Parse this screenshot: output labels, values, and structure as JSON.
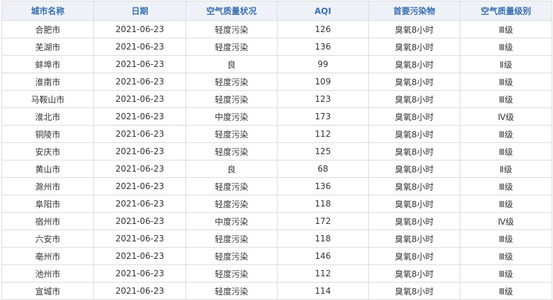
{
  "table": {
    "headers": [
      "城市名称",
      "日期",
      "空气质量状况",
      "AQI",
      "首要污染物",
      "空气质量级别"
    ],
    "rows": [
      [
        "合肥市",
        "2021-06-23",
        "轻度污染",
        "126",
        "臭氧8小时",
        "Ⅲ级"
      ],
      [
        "芜湖市",
        "2021-06-23",
        "轻度污染",
        "136",
        "臭氧8小时",
        "Ⅲ级"
      ],
      [
        "蚌埠市",
        "2021-06-23",
        "良",
        "99",
        "臭氧8小时",
        "Ⅱ级"
      ],
      [
        "淮南市",
        "2021-06-23",
        "轻度污染",
        "109",
        "臭氧8小时",
        "Ⅲ级"
      ],
      [
        "马鞍山市",
        "2021-06-23",
        "轻度污染",
        "123",
        "臭氧8小时",
        "Ⅲ级"
      ],
      [
        "淮北市",
        "2021-06-23",
        "中度污染",
        "173",
        "臭氧8小时",
        "Ⅳ级"
      ],
      [
        "铜陵市",
        "2021-06-23",
        "轻度污染",
        "112",
        "臭氧8小时",
        "Ⅲ级"
      ],
      [
        "安庆市",
        "2021-06-23",
        "轻度污染",
        "125",
        "臭氧8小时",
        "Ⅲ级"
      ],
      [
        "黄山市",
        "2021-06-23",
        "良",
        "68",
        "臭氧8小时",
        "Ⅱ级"
      ],
      [
        "滁州市",
        "2021-06-23",
        "轻度污染",
        "136",
        "臭氧8小时",
        "Ⅲ级"
      ],
      [
        "阜阳市",
        "2021-06-23",
        "轻度污染",
        "118",
        "臭氧8小时",
        "Ⅲ级"
      ],
      [
        "宿州市",
        "2021-06-23",
        "中度污染",
        "172",
        "臭氧8小时",
        "Ⅳ级"
      ],
      [
        "六安市",
        "2021-06-23",
        "轻度污染",
        "118",
        "臭氧8小时",
        "Ⅲ级"
      ],
      [
        "亳州市",
        "2021-06-23",
        "轻度污染",
        "146",
        "臭氧8小时",
        "Ⅲ级"
      ],
      [
        "池州市",
        "2021-06-23",
        "轻度污染",
        "112",
        "臭氧8小时",
        "Ⅲ级"
      ],
      [
        "宣城市",
        "2021-06-23",
        "轻度污染",
        "114",
        "臭氧8小时",
        "Ⅲ级"
      ]
    ]
  },
  "colors": {
    "header_text": "#3a6fb2",
    "header_bg": "#eef2f8",
    "border": "#dcdcdc",
    "cell_text": "#333333"
  }
}
